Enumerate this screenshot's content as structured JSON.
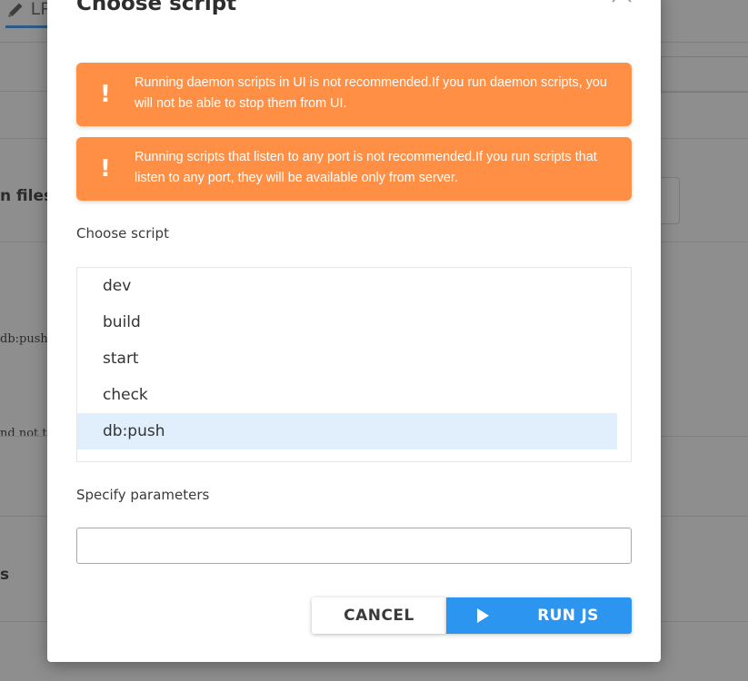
{
  "background": {
    "tab_label": "LF",
    "row_labels": [
      "n files",
      "db:push",
      "nd not t",
      "s"
    ]
  },
  "modal": {
    "title": "Choose script",
    "alerts": [
      {
        "icon": "!",
        "text": "Running daemon scripts in UI is not recommended.If you run daemon scripts, you will not be able to stop them from UI."
      },
      {
        "icon": "!",
        "text": "Running scripts that listen to any port is not recommended.If you run scripts that listen to any port, they will be available only from server."
      }
    ],
    "choose_label": "Choose script",
    "scripts": [
      "dev",
      "build",
      "start",
      "check",
      "db:push"
    ],
    "selected_script": "db:push",
    "params_label": "Specify parameters",
    "params_value": "",
    "cancel_label": "CANCEL",
    "run_label": "RUN JS SCRIPT"
  },
  "colors": {
    "alert": "#ff8f45",
    "primary": "#2b95f0",
    "selected_row": "#e1effc"
  }
}
